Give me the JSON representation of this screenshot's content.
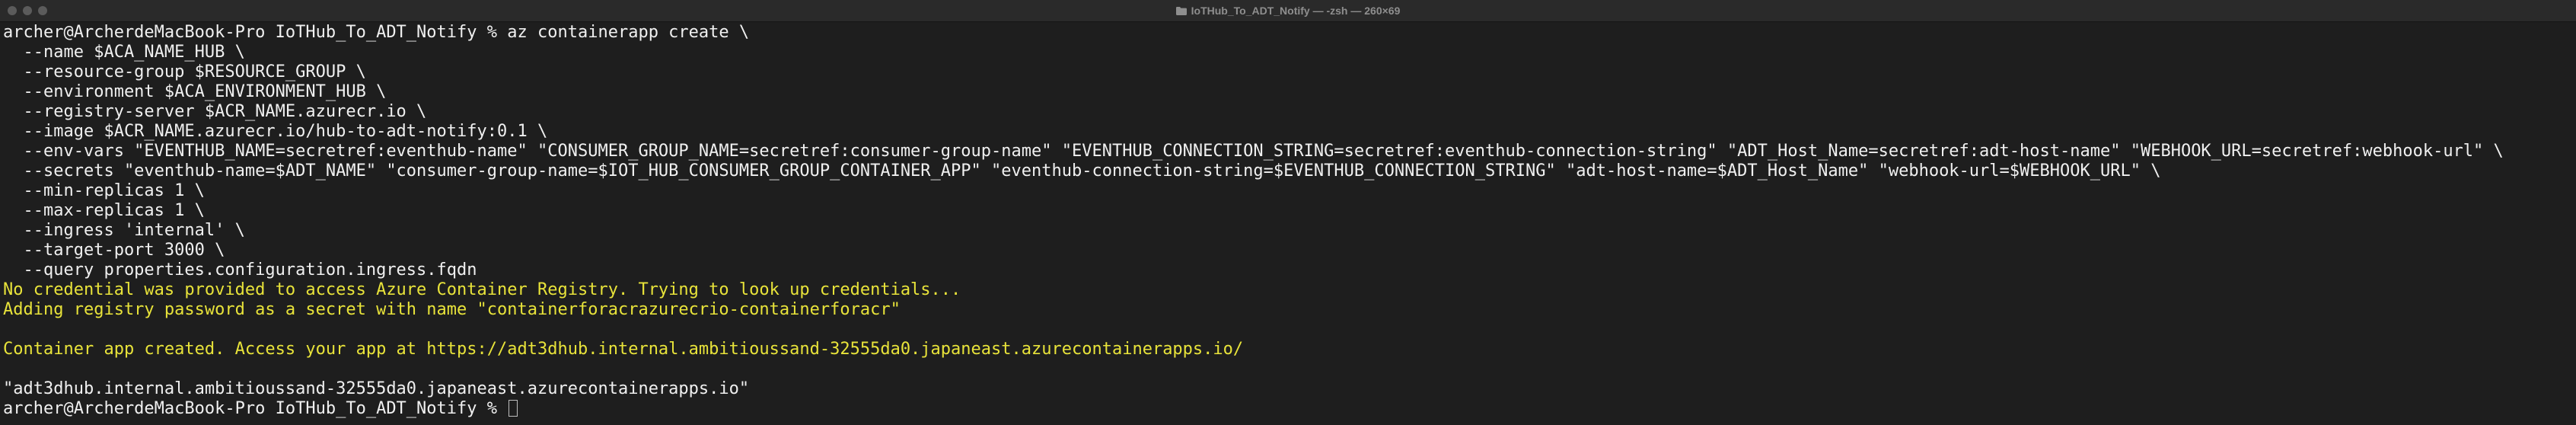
{
  "window": {
    "title": "IoTHub_To_ADT_Notify — -zsh — 260×69"
  },
  "terminal": {
    "lines": [
      "archer@ArcherdeMacBook-Pro IoTHub_To_ADT_Notify % az containerapp create \\",
      "  --name $ACA_NAME_HUB \\",
      "  --resource-group $RESOURCE_GROUP \\",
      "  --environment $ACA_ENVIRONMENT_HUB \\",
      "  --registry-server $ACR_NAME.azurecr.io \\",
      "  --image $ACR_NAME.azurecr.io/hub-to-adt-notify:0.1 \\",
      "  --env-vars \"EVENTHUB_NAME=secretref:eventhub-name\" \"CONSUMER_GROUP_NAME=secretref:consumer-group-name\" \"EVENTHUB_CONNECTION_STRING=secretref:eventhub-connection-string\" \"ADT_Host_Name=secretref:adt-host-name\" \"WEBHOOK_URL=secretref:webhook-url\" \\",
      "  --secrets \"eventhub-name=$ADT_NAME\" \"consumer-group-name=$IOT_HUB_CONSUMER_GROUP_CONTAINER_APP\" \"eventhub-connection-string=$EVENTHUB_CONNECTION_STRING\" \"adt-host-name=$ADT_Host_Name\" \"webhook-url=$WEBHOOK_URL\" \\",
      "  --min-replicas 1 \\",
      "  --max-replicas 1 \\",
      "  --ingress 'internal' \\",
      "  --target-port 3000 \\",
      "  --query properties.configuration.ingress.fqdn",
      "No credential was provided to access Azure Container Registry. Trying to look up credentials...",
      "Adding registry password as a secret with name \"containerforacrazurecrio-containerforacr\"",
      "",
      "Container app created. Access your app at https://adt3dhub.internal.ambitioussand-32555da0.japaneast.azurecontainerapps.io/",
      "",
      "\"adt3dhub.internal.ambitioussand-32555da0.japaneast.azurecontainerapps.io\"",
      "archer@ArcherdeMacBook-Pro IoTHub_To_ADT_Notify % "
    ]
  },
  "colors": {
    "background": "#1e1e1e",
    "text": "#f0f0f0",
    "warning": "#e8e33a"
  }
}
